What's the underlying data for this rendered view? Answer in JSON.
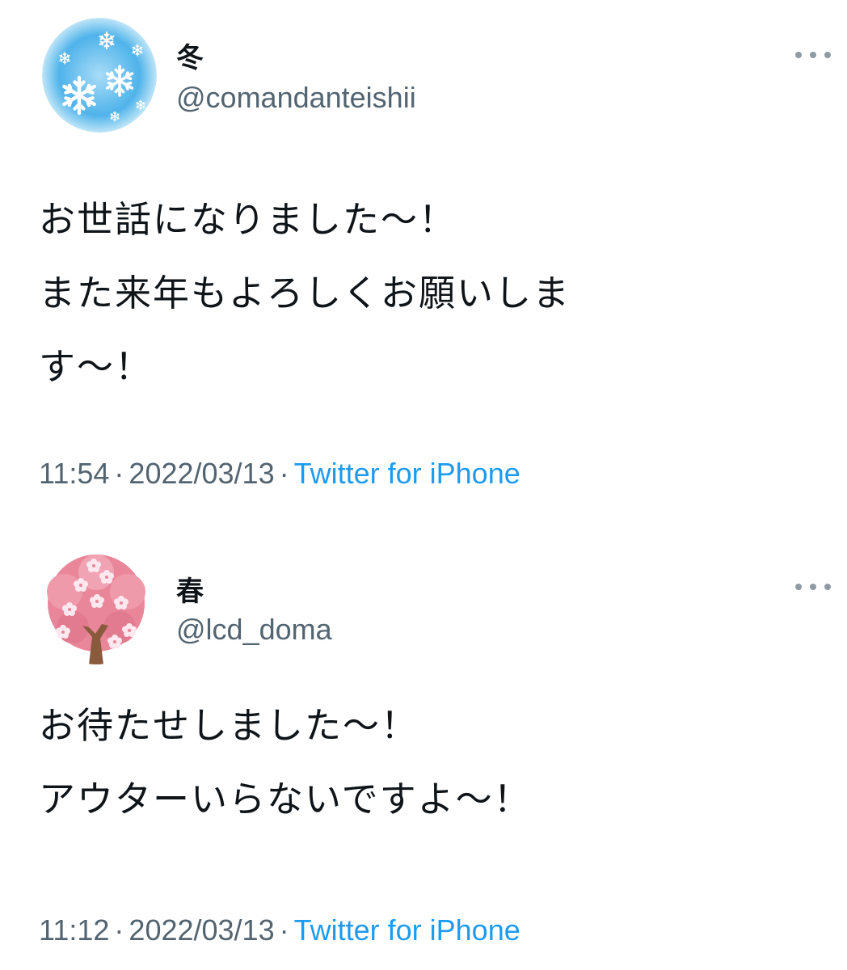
{
  "tweets": [
    {
      "avatar": "snowflake-avatar",
      "display_name": "冬",
      "handle": "@comandanteishii",
      "text_lines": [
        "お世話になりました～！",
        "また来年もよろしくお願いしま",
        "す～！"
      ],
      "time": "11:54",
      "date": "2022/03/13",
      "separator": "·",
      "source": "Twitter for iPhone",
      "more_icon": "more-options-icon"
    },
    {
      "avatar": "cherry-blossom-avatar",
      "display_name": "春",
      "handle": "@lcd_doma",
      "text_lines": [
        "お待たせしました～！",
        "アウターいらないですよ～！"
      ],
      "time": "11:12",
      "date": "2022/03/13",
      "separator": "·",
      "source": "Twitter for iPhone",
      "more_icon": "more-options-icon"
    }
  ],
  "colors": {
    "text": "#0f1419",
    "secondary": "#536471",
    "link": "#1d9bf0",
    "winter_sky": "#5ab8ea",
    "blossom_pink": "#e9869a"
  }
}
